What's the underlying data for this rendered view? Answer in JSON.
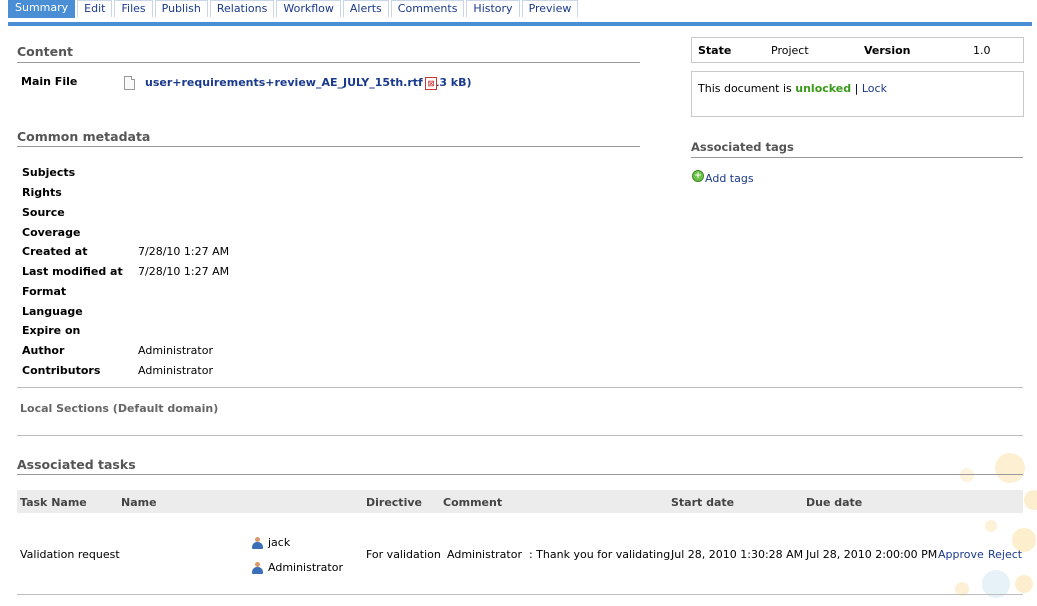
{
  "tabs": [
    {
      "label": "Summary",
      "active": true
    },
    {
      "label": "Edit"
    },
    {
      "label": "Files"
    },
    {
      "label": "Publish"
    },
    {
      "label": "Relations"
    },
    {
      "label": "Workflow"
    },
    {
      "label": "Alerts"
    },
    {
      "label": "Comments"
    },
    {
      "label": "History"
    },
    {
      "label": "Preview"
    }
  ],
  "content": {
    "title": "Content",
    "main_file_label": "Main File",
    "file_name": "user+requirements+review_AE_JULY_15th.rtf (13 kB)",
    "file_icon": "document-icon",
    "pdf_icon": "pdf-icon"
  },
  "metadata": {
    "title": "Common metadata",
    "fields": [
      {
        "label": "Subjects",
        "value": ""
      },
      {
        "label": "Rights",
        "value": ""
      },
      {
        "label": "Source",
        "value": ""
      },
      {
        "label": "Coverage",
        "value": ""
      },
      {
        "label": "Created at",
        "value": "7/28/10 1:27 AM"
      },
      {
        "label": "Last modified at",
        "value": "7/28/10 1:27 AM"
      },
      {
        "label": "Format",
        "value": ""
      },
      {
        "label": "Language",
        "value": ""
      },
      {
        "label": "Expire on",
        "value": ""
      },
      {
        "label": "Author",
        "value": "Administrator"
      },
      {
        "label": "Contributors",
        "value": "Administrator"
      }
    ]
  },
  "local_sections": {
    "title": "Local Sections (Default domain)"
  },
  "state": {
    "state_label": "State",
    "state_value": "Project",
    "version_label": "Version",
    "version_value": "1.0"
  },
  "lock": {
    "prefix": "This document is",
    "status": "unlocked",
    "separator": "|",
    "action": "Lock"
  },
  "tags": {
    "title": "Associated tags",
    "add_label": "Add tags",
    "add_icon": "add-icon"
  },
  "tasks": {
    "title": "Associated tasks",
    "headers": {
      "task_name": "Task Name",
      "name": "Name",
      "directive": "Directive",
      "comment": "Comment",
      "start_date": "Start date",
      "due_date": "Due date"
    },
    "row": {
      "task_name": "Validation request",
      "users": [
        "jack",
        "Administrator"
      ],
      "directive": "For validation",
      "comment": "Administrator  : Thank you for validating",
      "start_date": "Jul 28, 2010 1:30:28 AM",
      "due_date": "Jul 28, 2010 2:00:00 PM",
      "approve": "Approve",
      "reject": "Reject"
    }
  },
  "colors": {
    "accent": "#4a8fd6",
    "link": "#1a3a8c",
    "unlocked": "#3a9a1a"
  }
}
